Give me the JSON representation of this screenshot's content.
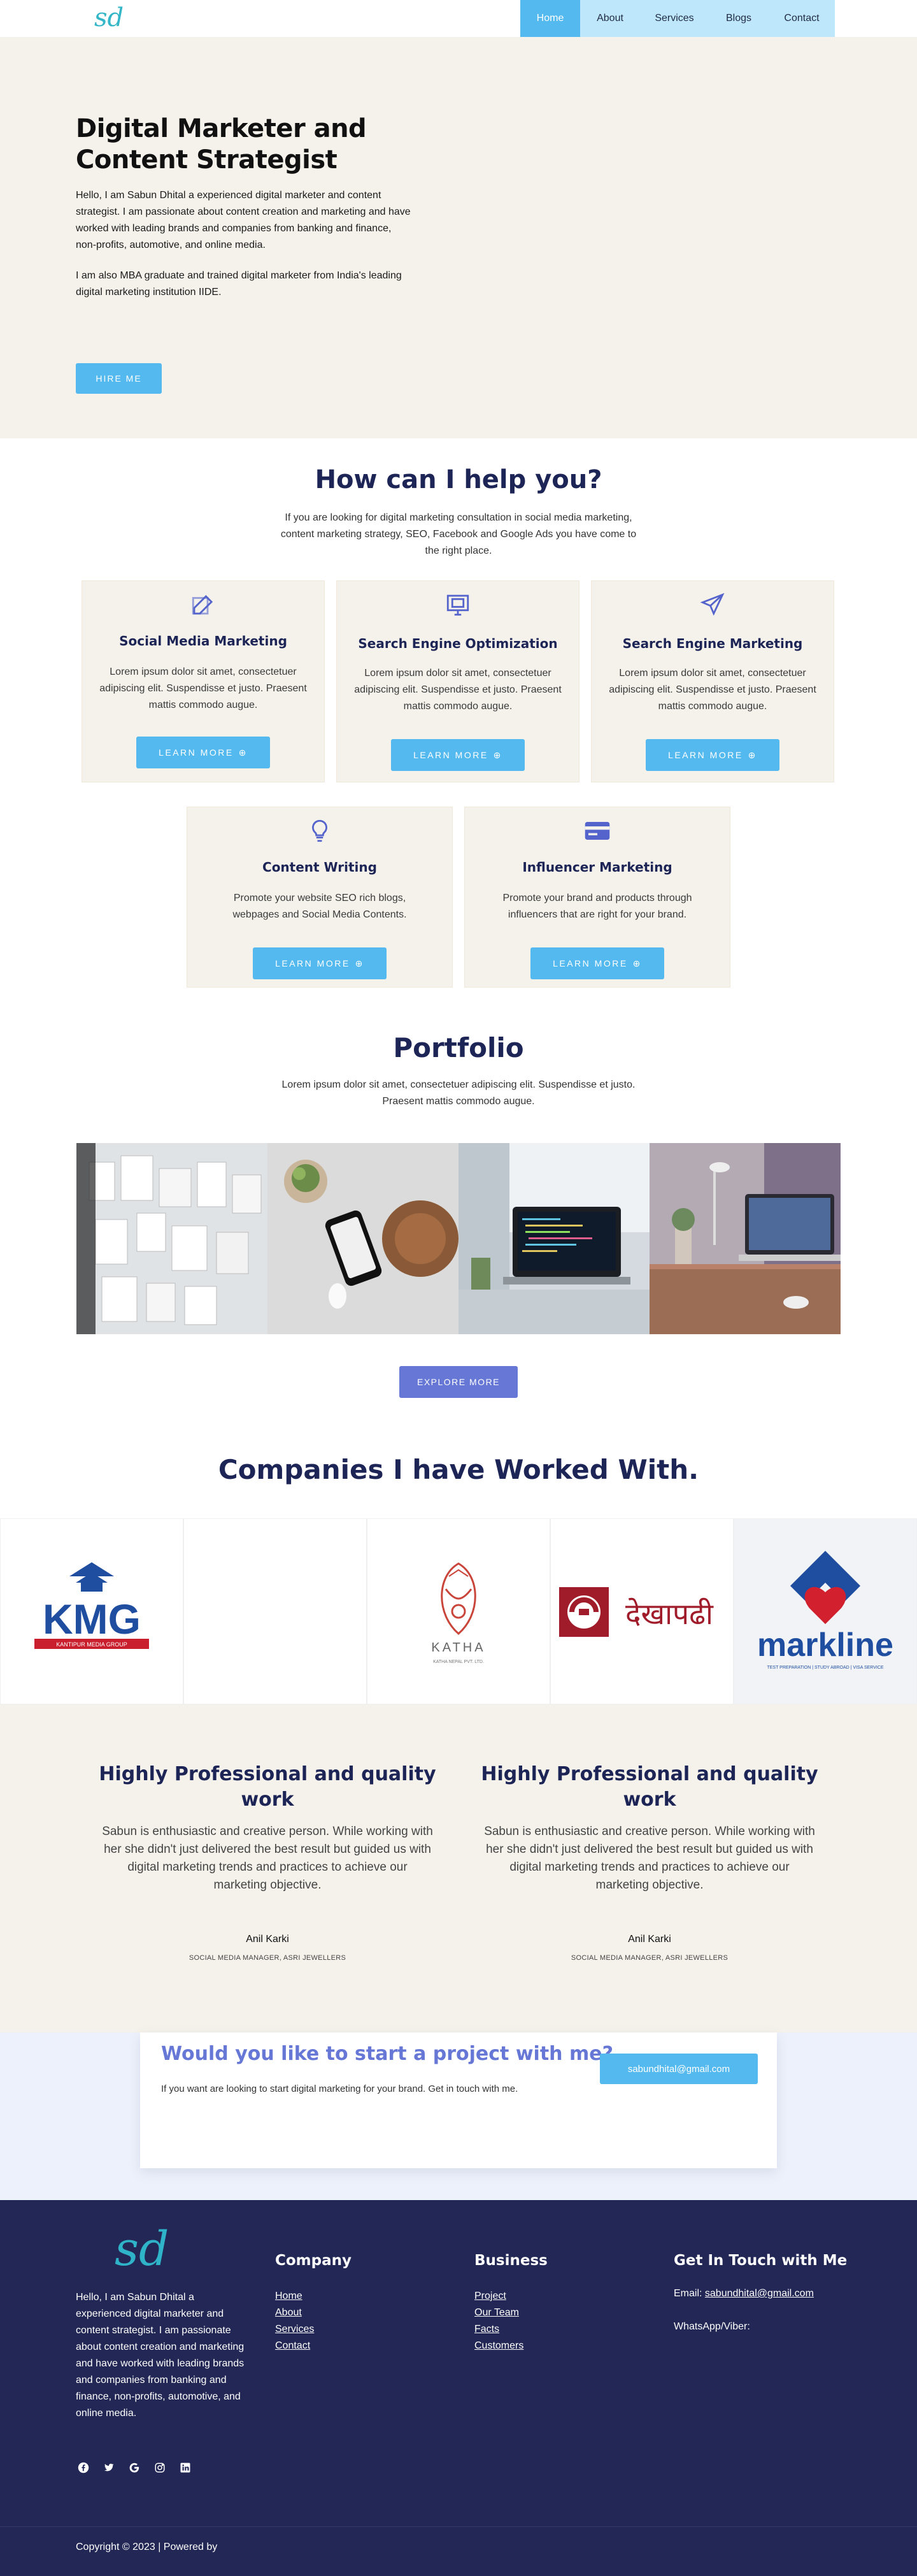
{
  "header": {
    "logo_text": "sd",
    "nav": [
      {
        "label": "Home",
        "active": true
      },
      {
        "label": "About",
        "active": false
      },
      {
        "label": "Services",
        "active": false
      },
      {
        "label": "Blogs",
        "active": false
      },
      {
        "label": "Contact",
        "active": false
      }
    ]
  },
  "hero": {
    "title": "Digital Marketer and Content Strategist",
    "paragraph1": "Hello, I am Sabun Dhital a experienced digital marketer and content strategist. I am passionate about content creation and marketing and have worked with leading brands and companies from banking and finance, non-profits, automotive, and online media.",
    "paragraph2": "I am also MBA graduate and trained digital marketer from India's leading digital marketing institution IIDE.",
    "button": "HIRE ME"
  },
  "services": {
    "title": "How can I help you?",
    "subtitle": "If you are looking for digital marketing consultation in social media marketing, content marketing strategy, SEO, Facebook and Google Ads you have come to the right place.",
    "cards": [
      {
        "icon": "edit-icon",
        "title": "Social Media Marketing",
        "desc": "Lorem ipsum dolor sit amet, consectetuer adipiscing elit. Suspendisse et justo. Praesent mattis commodo augue.",
        "button": "LEARN MORE"
      },
      {
        "icon": "monitor-icon",
        "title": "Search Engine Optimization",
        "desc": "Lorem ipsum dolor sit amet, consectetuer adipiscing elit. Suspendisse et justo. Praesent mattis commodo augue.",
        "button": "LEARN MORE"
      },
      {
        "icon": "paper-plane-icon",
        "title": "Search Engine Marketing",
        "desc": "Lorem ipsum dolor sit amet, consectetuer adipiscing elit. Suspendisse et justo. Praesent mattis commodo augue.",
        "button": "LEARN MORE"
      },
      {
        "icon": "lightbulb-icon",
        "title": "Content Writing",
        "desc": "Promote your website SEO rich blogs, webpages and Social Media Contents.",
        "button": "LEARN MORE"
      },
      {
        "icon": "credit-card-icon",
        "title": "Influencer Marketing",
        "desc": "Promote your brand and products through influencers that are right for your brand.",
        "button": "LEARN MORE"
      }
    ]
  },
  "portfolio": {
    "title": "Portfolio",
    "subtitle": "Lorem ipsum dolor sit amet, consectetuer adipiscing elit. Suspendisse et justo. Praesent mattis commodo augue.",
    "button": "EXPLORE MORE"
  },
  "companies": {
    "title": "Companies I have Worked With.",
    "logos": [
      {
        "name": "KMG",
        "caption": "KANTIPUR MEDIA GROUP"
      },
      {
        "name": "",
        "caption": ""
      },
      {
        "name": "KATHA",
        "caption": "KATHA NEPAL PVT. LTD."
      },
      {
        "name": "देखापढी",
        "caption": ""
      },
      {
        "name": "markline",
        "caption": "TEST PREPARATION | STUDY ABROAD | VISA SERVICE"
      }
    ]
  },
  "testimonials": [
    {
      "title": "Highly Professional and quality work",
      "text": "Sabun is enthusiastic and creative person. While working with her she didn't just delivered the best result but guided us with digital marketing trends and practices to achieve our marketing objective.",
      "name": "Anil Karki",
      "role": "SOCIAL MEDIA MANAGER, ASRI JEWELLERS"
    },
    {
      "title": "Highly Professional and quality work",
      "text": "Sabun is enthusiastic and creative person. While working with her she didn't just delivered the best result but guided us with digital marketing trends and practices to achieve our marketing objective.",
      "name": "Anil Karki",
      "role": "SOCIAL MEDIA MANAGER, ASRI JEWELLERS"
    }
  ],
  "cta": {
    "title": "Would you like to start a project with me?",
    "text": "If you want are looking to start digital marketing for your brand. Get in touch with me.",
    "button": "sabundhital@gmail.com"
  },
  "footer": {
    "logo_text": "sd",
    "about": "Hello, I am Sabun Dhital a experienced digital marketer and content strategist. I am passionate about content creation and marketing and have worked with leading brands and companies from banking and finance, non-profits, automotive, and online media.",
    "company_title": "Company",
    "company_links": [
      "Home",
      "About",
      "Services",
      "Contact"
    ],
    "business_title": "Business",
    "business_links": [
      "Project",
      "Our Team",
      "Facts",
      "Customers"
    ],
    "contact_title": "Get In Touch with Me",
    "email_label": "Email:",
    "email": "sabundhital@gmail.com",
    "whatsapp_label": "WhatsApp/Viber:",
    "social": [
      "facebook-icon",
      "twitter-icon",
      "google-icon",
      "instagram-icon",
      "linkedin-icon"
    ],
    "copyright": "Copyright © 2023 | Powered by"
  },
  "colors": {
    "accent_blue": "#54b9ef",
    "navy": "#1d2557",
    "purple": "#6677d6",
    "cream": "#f5f2eb",
    "footer_bg": "#222755"
  }
}
